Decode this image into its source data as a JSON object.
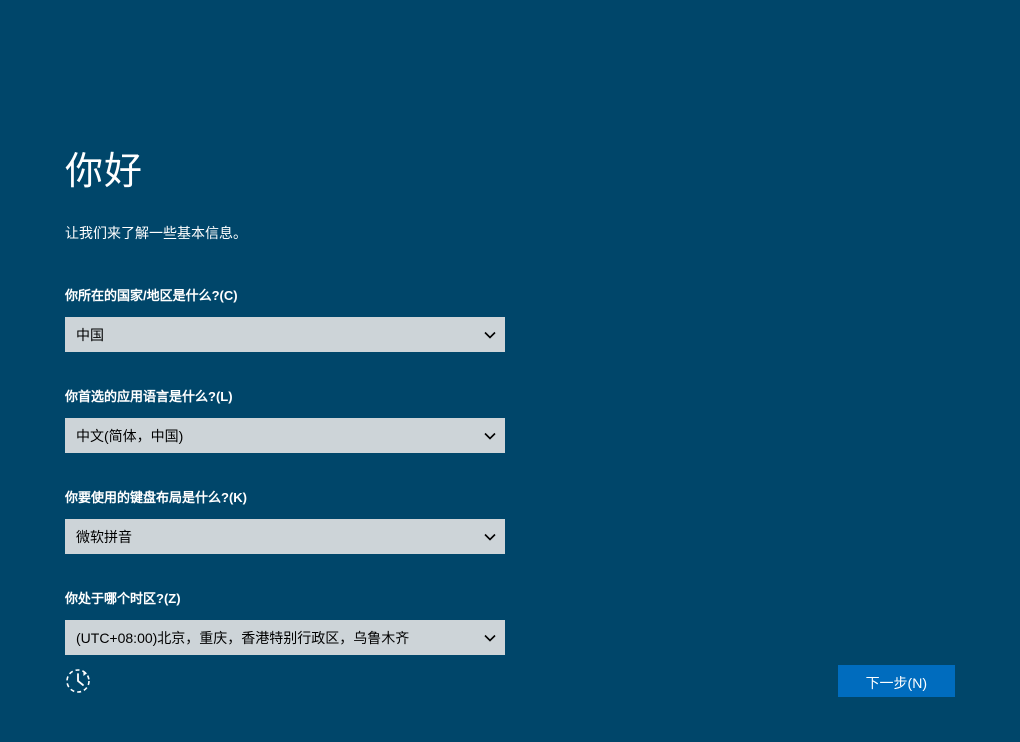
{
  "page": {
    "title": "你好",
    "subtitle": "让我们来了解一些基本信息。"
  },
  "form": {
    "country": {
      "label": "你所在的国家/地区是什么?(C)",
      "value": "中国"
    },
    "language": {
      "label": "你首选的应用语言是什么?(L)",
      "value": "中文(简体，中国)"
    },
    "keyboard": {
      "label": "你要使用的键盘布局是什么?(K)",
      "value": "微软拼音"
    },
    "timezone": {
      "label": "你处于哪个时区?(Z)",
      "value": "(UTC+08:00)北京，重庆，香港特别行政区，乌鲁木齐"
    }
  },
  "footer": {
    "next_label": "下一步(N)"
  },
  "colors": {
    "background": "#00466a",
    "select_bg": "#cdd4d8",
    "button_bg": "#006cbe"
  }
}
